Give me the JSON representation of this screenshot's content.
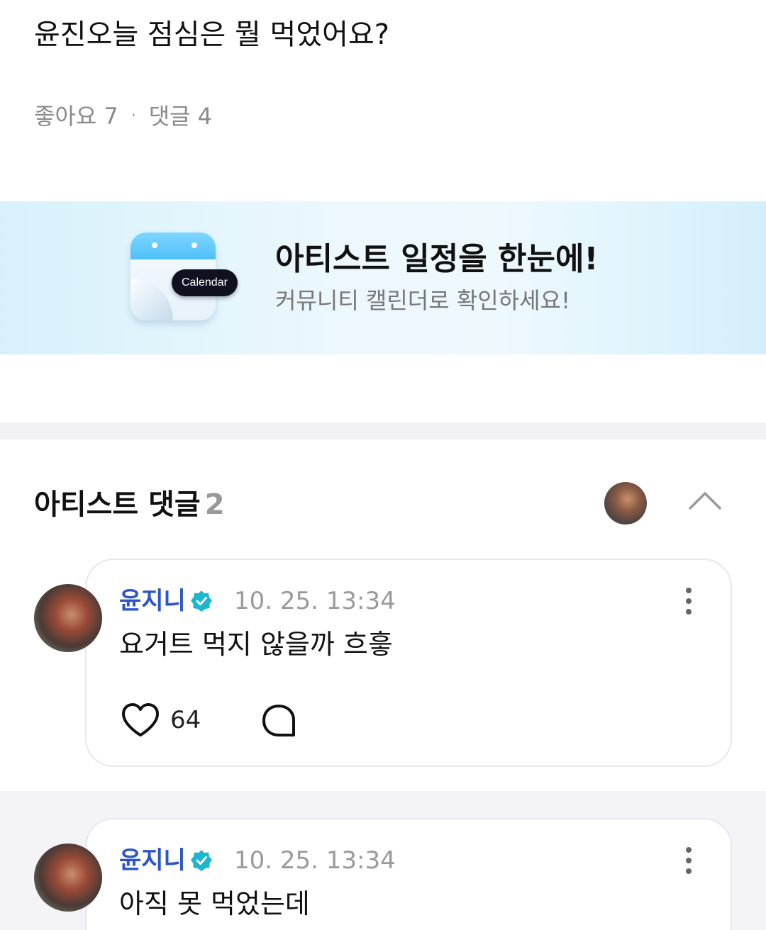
{
  "post": {
    "title": "윤진오늘 점심은 뭘 먹었어요?",
    "likes_label": "좋아요",
    "likes_count": "7",
    "separator": "·",
    "comments_label": "댓글",
    "comments_count": "4"
  },
  "banner": {
    "calendar_badge": "Calendar",
    "title": "아티스트 일정을 한눈에!",
    "subtitle": "커뮤니티 캘린더로 확인하세요!",
    "colors": {
      "icon_top": "#4fc0fb",
      "badge_bg": "#0f1120"
    }
  },
  "artist_comments": {
    "title": "아티스트 댓글",
    "count": "2",
    "icons": {
      "collapse": "chevron-up-icon"
    },
    "items": [
      {
        "author": "윤지니",
        "time": "10. 25. 13:34",
        "text": "요거트 먹지 않을까 흐흫",
        "likes": "64"
      },
      {
        "author": "윤지니",
        "time": "10. 25. 13:34",
        "text": "아직 못 먹었는데"
      }
    ]
  },
  "colors": {
    "author": "#2b55c8",
    "verified": "#1db6cf",
    "muted": "#9a9a9a"
  }
}
